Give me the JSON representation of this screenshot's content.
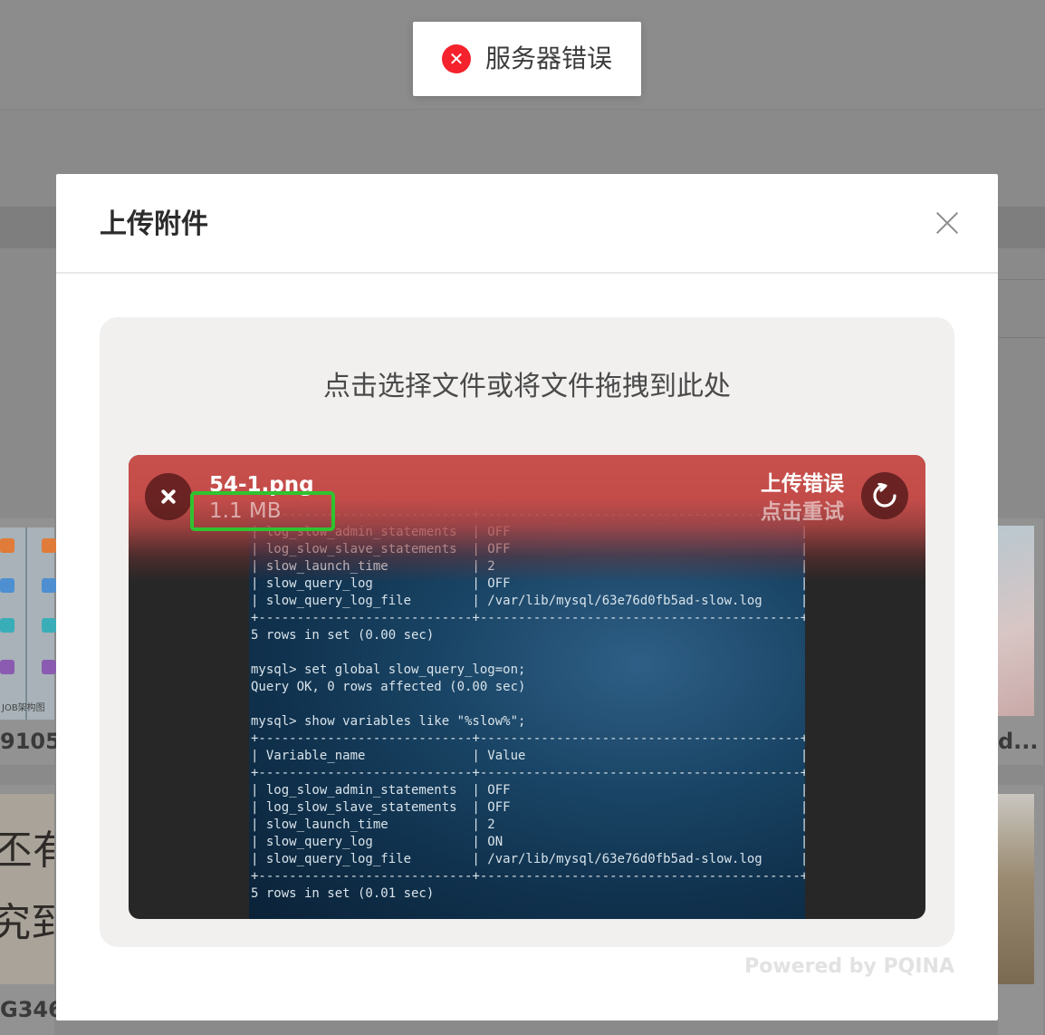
{
  "toast": {
    "icon": "error-circle-icon",
    "message": "服务器错误",
    "color": "#f5222d"
  },
  "background": {
    "left_card_caption_1": "9105",
    "left_card_caption_2": "G346",
    "right_card_caption": "d...",
    "left_thumb_text": "JOB架构图",
    "left_thumb_calligraphy_1": "丕有",
    "left_thumb_calligraphy_2": "究到"
  },
  "modal": {
    "title": "上传附件",
    "close_icon": "close-icon"
  },
  "uploader": {
    "drop_label": "点击选择文件或将文件拖拽到此处",
    "powered_by": "Powered by PQINA",
    "file": {
      "name": "54-1.png",
      "size": "1.1 MB",
      "status": "上传错误",
      "status_hint": "点击重试",
      "error_color": "#c8504c",
      "highlight_color": "#2fc32f",
      "preview_text": "| Variable_name              | Value                                    |\n+----------------------------+------------------------------------------+\n| log_slow_admin_statements  | OFF                                      |\n| log_slow_slave_statements  | OFF                                      |\n| slow_launch_time           | 2                                        |\n| slow_query_log             | OFF                                      |\n| slow_query_log_file        | /var/lib/mysql/63e76d0fb5ad-slow.log     |\n+----------------------------+------------------------------------------+\n5 rows in set (0.00 sec)\n\nmysql> set global slow_query_log=on;\nQuery OK, 0 rows affected (0.00 sec)\n\nmysql> show variables like \"%slow%\";\n+----------------------------+------------------------------------------+\n| Variable_name              | Value                                    |\n+----------------------------+------------------------------------------+\n| log_slow_admin_statements  | OFF                                      |\n| log_slow_slave_statements  | OFF                                      |\n| slow_launch_time           | 2                                        |\n| slow_query_log             | ON                                       |\n| slow_query_log_file        | /var/lib/mysql/63e76d0fb5ad-slow.log     |\n+----------------------------+------------------------------------------+\n5 rows in set (0.01 sec)"
    }
  }
}
